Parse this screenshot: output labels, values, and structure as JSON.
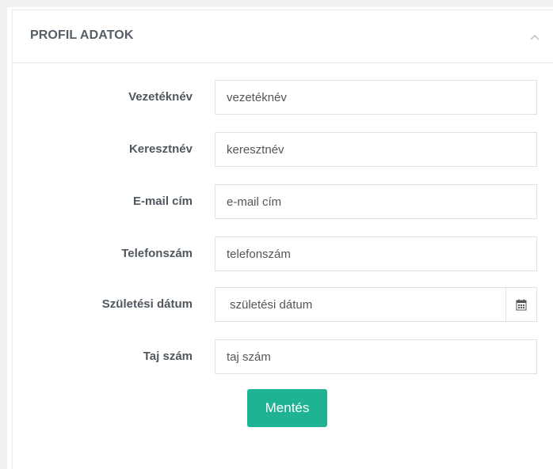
{
  "panel": {
    "title": "PROFIL ADATOK",
    "collapse_icon": "chevron-up-icon"
  },
  "form": {
    "fields": [
      {
        "label": "Vezetéknév",
        "placeholder": "vezetéknév"
      },
      {
        "label": "Keresztnév",
        "placeholder": "keresztnév"
      },
      {
        "label": "E-mail cím",
        "placeholder": "e-mail cím"
      },
      {
        "label": "Telefonszám",
        "placeholder": "telefonszám"
      },
      {
        "label": "Születési dátum",
        "placeholder": "születési dátum",
        "icon": "calendar-icon"
      },
      {
        "label": "Taj szám",
        "placeholder": "taj szám"
      }
    ],
    "save_label": "Mentés"
  },
  "colors": {
    "accent": "#1fb393",
    "label_text": "#4f575e",
    "border": "#dfe3e7"
  }
}
